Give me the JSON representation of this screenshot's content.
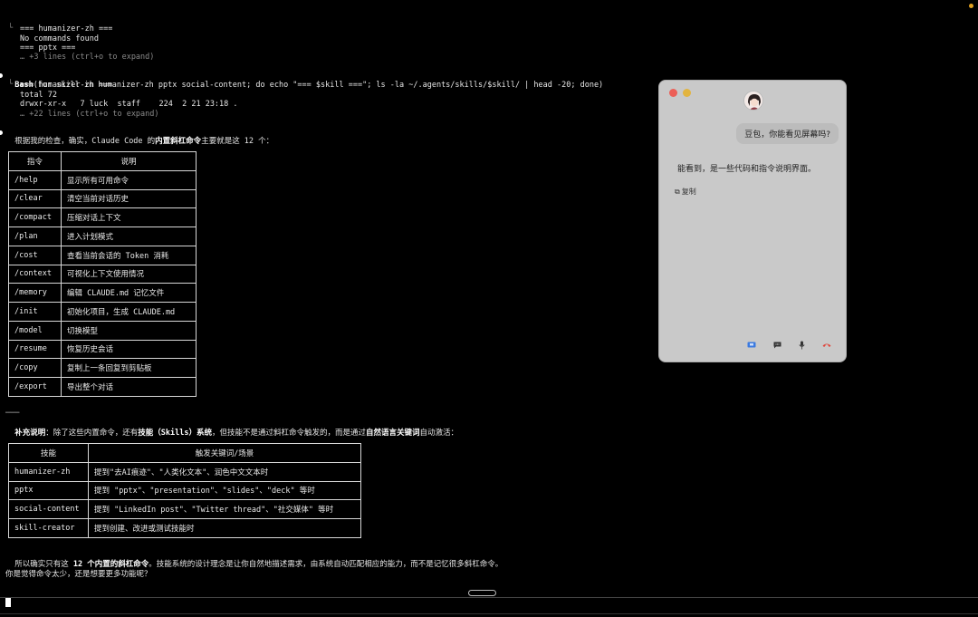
{
  "terminal": {
    "pre_lines": [
      "=== humanizer-zh ===",
      "No commands found",
      "=== pptx ===",
      "… +3 lines (ctrl+o to expand)"
    ],
    "bash_keyword": "Bash",
    "bash_command": "(for skill in humanizer-zh pptx social-content; do echo \"=== $skill ===\"; ls -la ~/.agents/skills/$skill/ | head -20; done)",
    "bash_output": [
      "=== humanizer-zh ===",
      "total 72",
      "drwxr-xr-x   7 luck  staff    224  2 21 23:18 .",
      "… +22 lines (ctrl+o to expand)"
    ],
    "summary_pre": "根据我的检查，确实，Claude Code 的",
    "summary_bold": "内置斜杠命令",
    "summary_post": "主要就是这 12 个：",
    "commands_table": {
      "headers": [
        "指令",
        "说明"
      ],
      "rows": [
        [
          "/help",
          "显示所有可用命令"
        ],
        [
          "/clear",
          "清空当前对话历史"
        ],
        [
          "/compact",
          "压缩对话上下文"
        ],
        [
          "/plan",
          "进入计划模式"
        ],
        [
          "/cost",
          "查看当前会话的 Token 消耗"
        ],
        [
          "/context",
          "可视化上下文使用情况"
        ],
        [
          "/memory",
          "编辑 CLAUDE.md 记忆文件"
        ],
        [
          "/init",
          "初始化项目，生成 CLAUDE.md"
        ],
        [
          "/model",
          "切换模型"
        ],
        [
          "/resume",
          "恢复历史会话"
        ],
        [
          "/copy",
          "复制上一条回复到剪贴板"
        ],
        [
          "/export",
          "导出整个对话"
        ]
      ]
    },
    "hr": "───",
    "supplement_bold1": "补充说明",
    "supplement_mid1": "：除了这些内置命令，还有",
    "supplement_bold2": "技能（Skills）系统",
    "supplement_mid2": "，但技能不是通过斜杠命令触发的，而是通过",
    "supplement_bold3": "自然语言关键词",
    "supplement_post": "自动激活：",
    "skills_table": {
      "headers": [
        "技能",
        "触发关键词/场景"
      ],
      "rows": [
        [
          "humanizer-zh",
          "提到\"去AI痕迹\"、\"人类化文本\"、润色中文文本时"
        ],
        [
          "pptx",
          "提到 \"pptx\"、\"presentation\"、\"slides\"、\"deck\" 等时"
        ],
        [
          "social-content",
          "提到 \"LinkedIn post\"、\"Twitter thread\"、\"社交媒体\" 等时"
        ],
        [
          "skill-creator",
          "提到创建、改进或测试技能时"
        ]
      ]
    },
    "conclusion_pre": "所以确实只有这 ",
    "conclusion_bold": "12 个内置的斜杠命令",
    "conclusion_post": "。技能系统的设计理念是让你自然地描述需求，由系统自动匹配相应的能力，而不是记忆很多斜杠命令。",
    "question": "你是觉得命令太少，还是想要更多功能呢？"
  },
  "chat": {
    "user_message": "豆包，你能看见屏幕吗?",
    "reply": "能看到，是一些代码和指令说明界面。",
    "copy_label": "复制"
  },
  "colors": {
    "background": "#000000",
    "chat_panel": "#c9c9c9",
    "close": "#ec5f57",
    "minimize": "#e2b43f"
  }
}
